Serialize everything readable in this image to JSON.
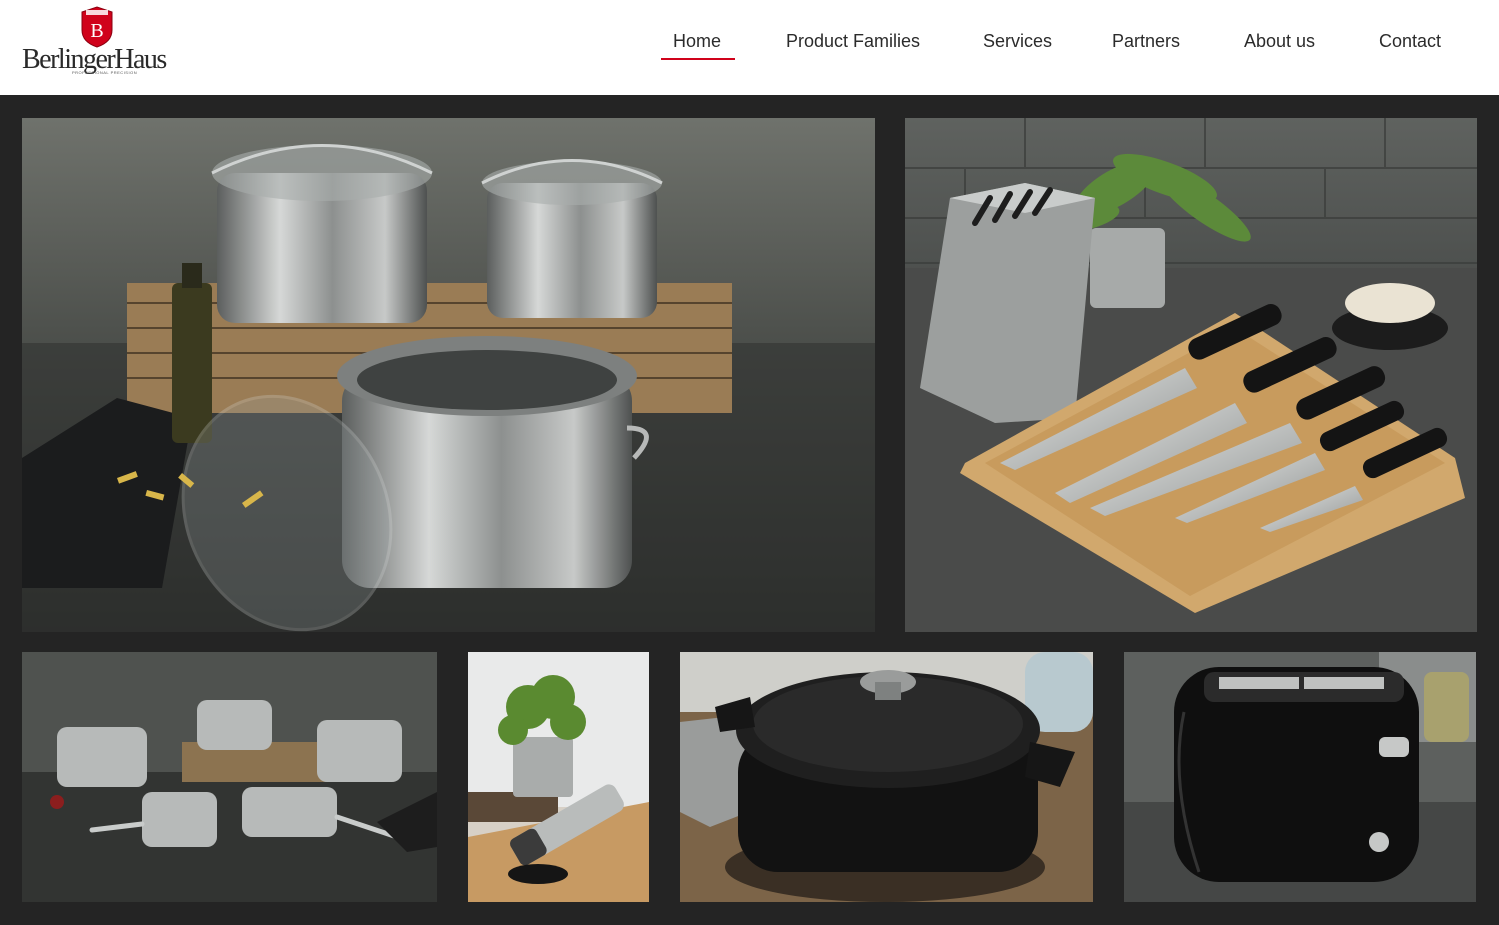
{
  "brand": {
    "name": "BerlingerHaus",
    "shield_letter": "B",
    "tagline": "PROFESSIONAL PRECISION",
    "accent_color": "#d0021b"
  },
  "nav": {
    "items": [
      {
        "label": "Home",
        "active": true
      },
      {
        "label": "Product Families",
        "active": false
      },
      {
        "label": "Services",
        "active": false
      },
      {
        "label": "Partners",
        "active": false
      },
      {
        "label": "About us",
        "active": false
      },
      {
        "label": "Contact",
        "active": false
      }
    ]
  },
  "gallery": {
    "background_color": "#242424",
    "tiles": [
      {
        "subject": "stainless steel pot set"
      },
      {
        "subject": "knife set with stand"
      },
      {
        "subject": "cookware set"
      },
      {
        "subject": "salt and pepper mill"
      },
      {
        "subject": "cast iron casserole"
      },
      {
        "subject": "black toaster"
      }
    ]
  }
}
